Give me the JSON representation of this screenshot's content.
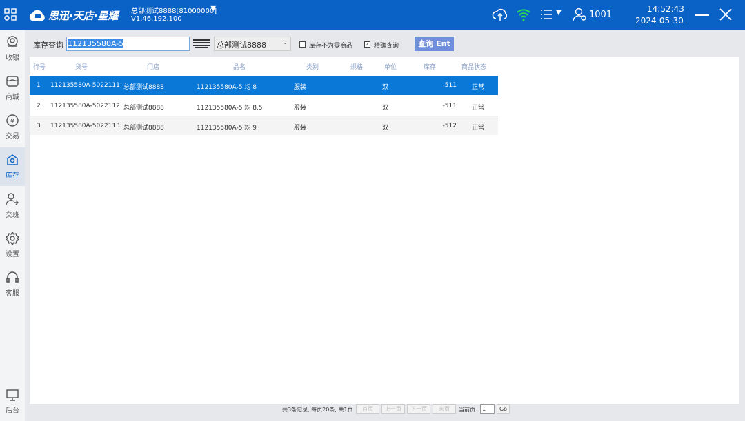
{
  "header": {
    "brand": "思迅·天店·星耀",
    "store": "总部测试8888[81000000]",
    "version": "V1.46.192.100",
    "user": "1001",
    "time": "14:52:43",
    "date": "2024-05-30"
  },
  "sidebar": {
    "items": [
      {
        "label": "收银",
        "icon": "cashier-icon"
      },
      {
        "label": "商城",
        "icon": "store-icon"
      },
      {
        "label": "交易",
        "icon": "yuan-icon"
      },
      {
        "label": "库存",
        "icon": "inventory-icon",
        "active": true
      },
      {
        "label": "交班",
        "icon": "shift-icon"
      },
      {
        "label": "设置",
        "icon": "gear-icon"
      },
      {
        "label": "客服",
        "icon": "headset-icon"
      }
    ],
    "bottom": {
      "label": "后台",
      "icon": "monitor-icon"
    }
  },
  "toolbar": {
    "label": "库存查询",
    "search_value": "112135580A-5",
    "store_select": "总部测试8888",
    "nonzero_label": "库存不为零商品",
    "nonzero_checked": false,
    "exact_label": "精确查询",
    "exact_checked": true,
    "query_button": "查询 Ent"
  },
  "table": {
    "headers": [
      "行号",
      "货号",
      "门店",
      "品名",
      "类别",
      "规格",
      "单位",
      "库存",
      "商品状态"
    ],
    "rows": [
      [
        "1",
        "112135580A-5022111",
        "总部测试8888",
        "112135580A-5 均 8",
        "服装",
        "",
        "双",
        "-511",
        "正常"
      ],
      [
        "2",
        "112135580A-5022112",
        "总部测试8888",
        "112135580A-5 均 8.5",
        "服装",
        "",
        "双",
        "-511",
        "正常"
      ],
      [
        "3",
        "112135580A-5022113",
        "总部测试8888",
        "112135580A-5 均 9",
        "服装",
        "",
        "双",
        "-512",
        "正常"
      ]
    ],
    "selected_row": 0
  },
  "footer": {
    "summary": "共3条记录, 每页20条, 共1页",
    "first": "首页",
    "prev": "上一页",
    "next": "下一页",
    "last": "末页",
    "current_label": "当前页:",
    "current_page": "1",
    "go": "Go"
  },
  "colors": {
    "header": "#0b62c6",
    "selected": "#0a78d7",
    "button": "#6f8fdc",
    "wifi": "#2ee04a"
  }
}
